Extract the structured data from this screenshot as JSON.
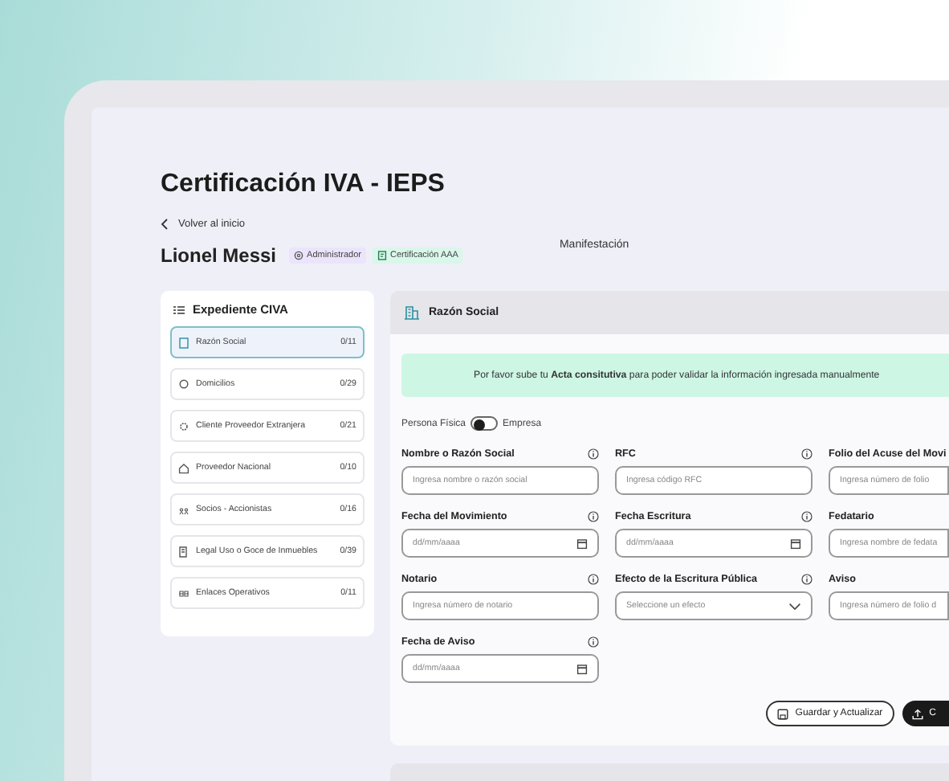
{
  "page": {
    "title": "Certificación IVA - IEPS",
    "back_link": "Volver al inicio",
    "user_name": "Lionel Messi",
    "badges": [
      {
        "label": "Administrador",
        "color": "#ebe4fb"
      },
      {
        "label": "Certificación AAA",
        "color": "#d9f7ea"
      }
    ],
    "tab_label": "Manifestación"
  },
  "sidebar": {
    "title": "Expediente CIVA",
    "items": [
      {
        "label": "Razón Social",
        "count": "0/11",
        "selected": true
      },
      {
        "label": "Domicilios",
        "count": "0/29",
        "selected": false
      },
      {
        "label": "Cliente Proveedor Extranjera",
        "count": "0/21",
        "selected": false
      },
      {
        "label": "Proveedor Nacional",
        "count": "0/10",
        "selected": false
      },
      {
        "label": "Socios - Accionistas",
        "count": "0/16",
        "selected": false
      },
      {
        "label": "Legal Uso o Goce de Inmuebles",
        "count": "0/39",
        "selected": false
      },
      {
        "label": "Enlaces Operativos",
        "count": "0/11",
        "selected": false
      }
    ]
  },
  "panel": {
    "title": "Razón Social",
    "notice": "Por favor sube tu **Acta consitutiva** para poder validar la información ingresada manualmente",
    "toggle": {
      "left_label": "Persona Física",
      "right_label": "Empresa",
      "on": false
    },
    "fields": [
      {
        "kind": "text",
        "label": "Nombre o Razón Social",
        "info": true,
        "placeholder": "Ingresa nombre o razón social"
      },
      {
        "kind": "text",
        "label": "RFC",
        "info": true,
        "placeholder": "Ingresa código RFC"
      },
      {
        "kind": "text",
        "label": "Folio del Acuse del Movi",
        "info": false,
        "placeholder": "Ingresa número de folio"
      },
      {
        "kind": "date",
        "label": "Fecha del Movimiento",
        "info": true,
        "placeholder": "dd/mm/aaaa"
      },
      {
        "kind": "date",
        "label": "Fecha Escritura",
        "info": true,
        "placeholder": "dd/mm/aaaa"
      },
      {
        "kind": "text",
        "label": "Fedatario",
        "info": false,
        "placeholder": "Ingresa nombre de fedata"
      },
      {
        "kind": "text",
        "label": "Notario",
        "info": true,
        "placeholder": "Ingresa número de notario"
      },
      {
        "kind": "select",
        "label": "Efecto de la Escritura Pública",
        "info": true,
        "placeholder": "Seleccione un efecto"
      },
      {
        "kind": "text",
        "label": "Aviso",
        "info": false,
        "placeholder": "Ingresa número de folio d"
      },
      {
        "kind": "date",
        "label": "Fecha de Aviso",
        "info": true,
        "placeholder": "dd/mm/aaaa"
      }
    ],
    "buttons": [
      {
        "kind": "outline",
        "label": "Guardar y Actualizar"
      },
      {
        "kind": "primary",
        "label": "C"
      }
    ]
  }
}
